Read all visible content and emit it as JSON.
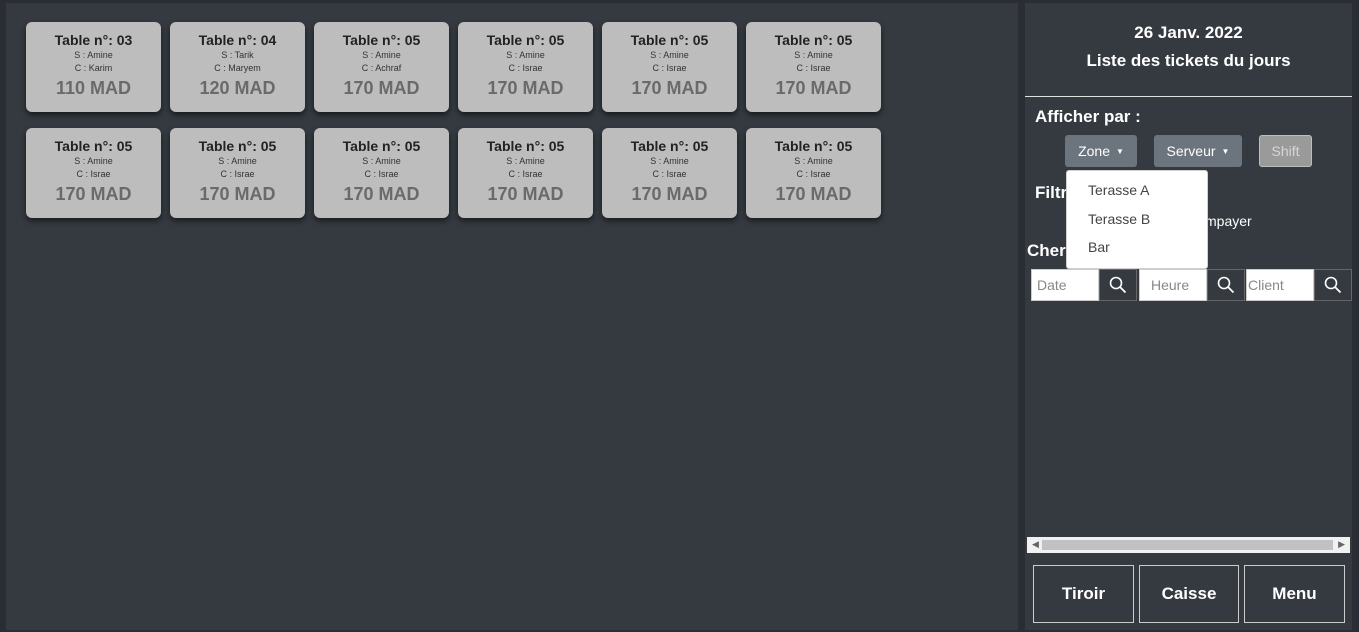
{
  "tickets": [
    {
      "title": "Table n°: 03",
      "server": "S : Amine",
      "client": "C : Karim",
      "amount": "110 MAD"
    },
    {
      "title": "Table n°: 04",
      "server": "S : Tarik",
      "client": "C : Maryem",
      "amount": "120 MAD"
    },
    {
      "title": "Table n°: 05",
      "server": "S : Amine",
      "client": "C : Achraf",
      "amount": "170 MAD"
    },
    {
      "title": "Table n°: 05",
      "server": "S : Amine",
      "client": "C : Israe",
      "amount": "170 MAD"
    },
    {
      "title": "Table n°: 05",
      "server": "S : Amine",
      "client": "C : Israe",
      "amount": "170 MAD"
    },
    {
      "title": "Table n°: 05",
      "server": "S : Amine",
      "client": "C : Israe",
      "amount": "170 MAD"
    },
    {
      "title": "Table n°: 05",
      "server": "S : Amine",
      "client": "C : Israe",
      "amount": "170 MAD"
    },
    {
      "title": "Table n°: 05",
      "server": "S : Amine",
      "client": "C : Israe",
      "amount": "170 MAD"
    },
    {
      "title": "Table n°: 05",
      "server": "S : Amine",
      "client": "C : Israe",
      "amount": "170 MAD"
    },
    {
      "title": "Table n°: 05",
      "server": "S : Amine",
      "client": "C : Israe",
      "amount": "170 MAD"
    },
    {
      "title": "Table n°: 05",
      "server": "S : Amine",
      "client": "C : Israe",
      "amount": "170 MAD"
    },
    {
      "title": "Table n°: 05",
      "server": "S : Amine",
      "client": "C : Israe",
      "amount": "170 MAD"
    }
  ],
  "sidebar": {
    "date": "26 Janv. 2022",
    "title": "Liste des tickets du jours",
    "afficher_label": "Afficher par :",
    "zone_label": "Zone",
    "serveur_label": "Serveur",
    "shift_label": "Shift",
    "filtrer_label": "Filtr",
    "impayer_label": "mpayer",
    "chercher_label": "Cher",
    "zone_options": [
      "Terasse A",
      "Terasse B",
      "Bar"
    ],
    "search": {
      "date_placeholder": "Date",
      "heure_placeholder": "Heure",
      "client_placeholder": "Client"
    }
  },
  "footer_buttons": {
    "tiroir": "Tiroir",
    "caisse": "Caisse",
    "menu": "Menu"
  },
  "colors": {
    "panel_bg": "#343a40",
    "ticket_bg": "#bdbdbd",
    "dropdown_button_bg": "#6c757d"
  }
}
